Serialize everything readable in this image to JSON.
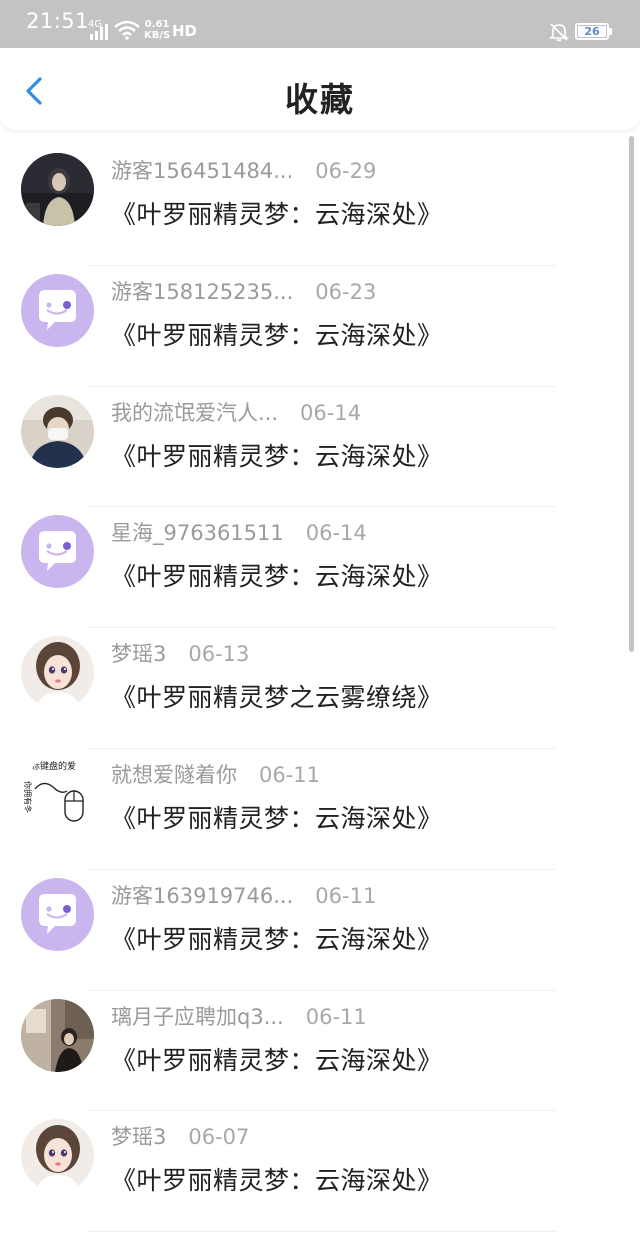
{
  "status_bar": {
    "time": "21:51",
    "network": "4G",
    "speed_value": "0.61",
    "speed_unit": "KB/S",
    "hd_label": "HD",
    "battery": "26"
  },
  "header": {
    "title": "收藏",
    "back_icon": "chevron-left-icon"
  },
  "favorites": [
    {
      "user": "游客156451484...",
      "date": "06-29",
      "title": "《叶罗丽精灵梦：云海深处》",
      "avatar": "photo-dark-girl"
    },
    {
      "user": "游客158125235...",
      "date": "06-23",
      "title": "《叶罗丽精灵梦：云海深处》",
      "avatar": "default-chat-bubble"
    },
    {
      "user": "我的流氓爱汽人...",
      "date": "06-14",
      "title": "《叶罗丽精灵梦：云海深处》",
      "avatar": "photo-masked-boy"
    },
    {
      "user": "星海_976361511",
      "date": "06-14",
      "title": "《叶罗丽精灵梦：云海深处》",
      "avatar": "default-chat-bubble"
    },
    {
      "user": "梦瑶3",
      "date": "06-13",
      "title": "《叶罗丽精灵梦之云雾缭绕》",
      "avatar": "photo-doll-girl"
    },
    {
      "user": "就想爱隧着你",
      "date": "06-11",
      "title": "《叶罗丽精灵梦：云海深处》",
      "avatar": "mouse-sketch",
      "avatar_text_top": "标键盘的爱",
      "avatar_text_side": "你拥有冬"
    },
    {
      "user": "游客163919746...",
      "date": "06-11",
      "title": "《叶罗丽精灵梦：云海深处》",
      "avatar": "default-chat-bubble"
    },
    {
      "user": "璃月子应聘加q3...",
      "date": "06-11",
      "title": "《叶罗丽精灵梦：云海深处》",
      "avatar": "photo-room-girl"
    },
    {
      "user": "梦瑶3",
      "date": "06-07",
      "title": "《叶罗丽精灵梦：云海深处》",
      "avatar": "photo-doll-girl"
    }
  ],
  "colors": {
    "status_bar_bg": "#c3c3c5",
    "accent": "#2f8fe0",
    "default_avatar_bg": "#c9b6ee",
    "meta_text": "#9a9a9a",
    "title_text": "#222222"
  }
}
